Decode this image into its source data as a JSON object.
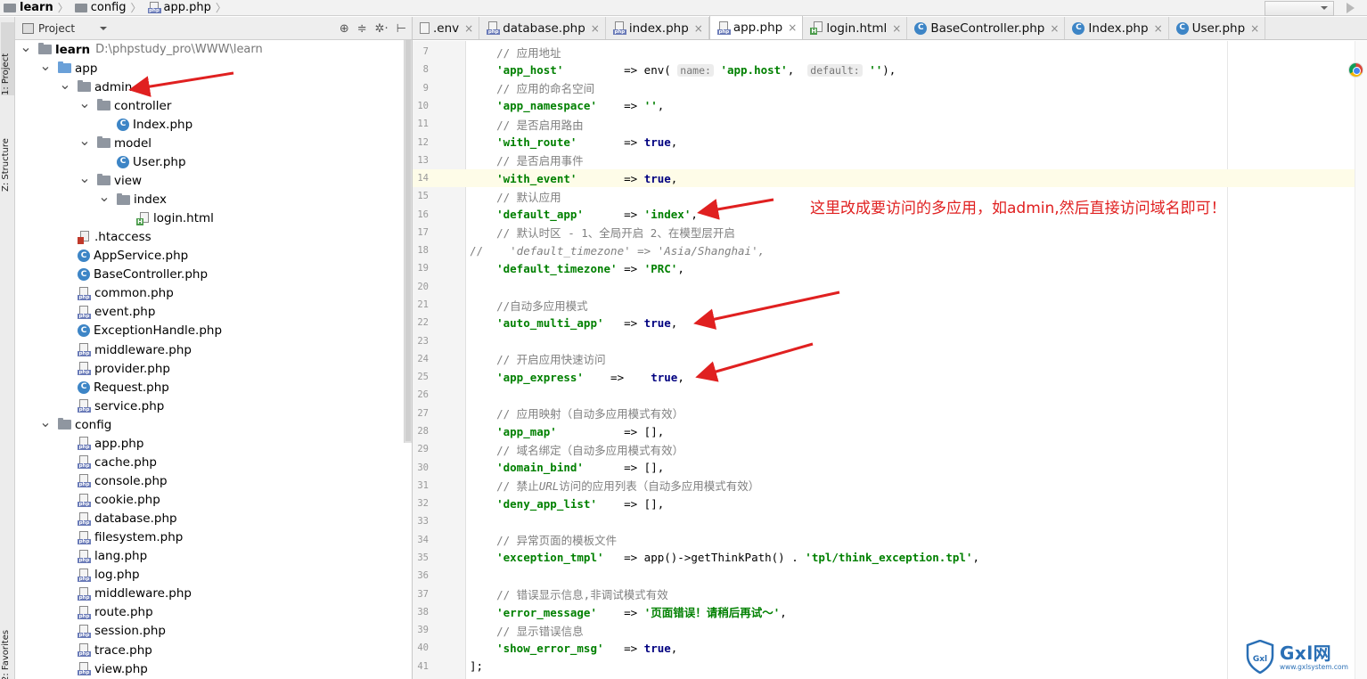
{
  "breadcrumb": [
    {
      "label": "learn",
      "icon": "folder-icon",
      "bold": true
    },
    {
      "label": "config",
      "icon": "folder-icon",
      "bold": false
    },
    {
      "label": "app.php",
      "icon": "php-file-icon",
      "bold": false
    }
  ],
  "tool_stripe": {
    "project_tab": "1: Project",
    "structure_tab": "Z: Structure",
    "favorites_tab": "2: Favorites"
  },
  "project_panel": {
    "title": "Project",
    "tree": [
      {
        "depth": 0,
        "arrow": "down",
        "icon": "folder",
        "label": "learn",
        "bold": true,
        "path": "D:\\phpstudy_pro\\WWW\\learn"
      },
      {
        "depth": 1,
        "arrow": "down",
        "icon": "folder-blue",
        "label": "app"
      },
      {
        "depth": 2,
        "arrow": "down",
        "icon": "folder",
        "label": "admin"
      },
      {
        "depth": 3,
        "arrow": "down",
        "icon": "folder",
        "label": "controller"
      },
      {
        "depth": 4,
        "arrow": "",
        "icon": "class",
        "label": "Index.php"
      },
      {
        "depth": 3,
        "arrow": "down",
        "icon": "folder",
        "label": "model"
      },
      {
        "depth": 4,
        "arrow": "",
        "icon": "class",
        "label": "User.php"
      },
      {
        "depth": 3,
        "arrow": "down",
        "icon": "folder",
        "label": "view"
      },
      {
        "depth": 4,
        "arrow": "down",
        "icon": "folder",
        "label": "index"
      },
      {
        "depth": 5,
        "arrow": "",
        "icon": "html",
        "label": "login.html"
      },
      {
        "depth": 2,
        "arrow": "",
        "icon": "htaccess",
        "label": ".htaccess"
      },
      {
        "depth": 2,
        "arrow": "",
        "icon": "class",
        "label": "AppService.php"
      },
      {
        "depth": 2,
        "arrow": "",
        "icon": "class",
        "label": "BaseController.php"
      },
      {
        "depth": 2,
        "arrow": "",
        "icon": "php",
        "label": "common.php"
      },
      {
        "depth": 2,
        "arrow": "",
        "icon": "php",
        "label": "event.php"
      },
      {
        "depth": 2,
        "arrow": "",
        "icon": "class",
        "label": "ExceptionHandle.php"
      },
      {
        "depth": 2,
        "arrow": "",
        "icon": "php",
        "label": "middleware.php"
      },
      {
        "depth": 2,
        "arrow": "",
        "icon": "php",
        "label": "provider.php"
      },
      {
        "depth": 2,
        "arrow": "",
        "icon": "class",
        "label": "Request.php"
      },
      {
        "depth": 2,
        "arrow": "",
        "icon": "php",
        "label": "service.php"
      },
      {
        "depth": 1,
        "arrow": "down",
        "icon": "folder",
        "label": "config"
      },
      {
        "depth": 2,
        "arrow": "",
        "icon": "php",
        "label": "app.php"
      },
      {
        "depth": 2,
        "arrow": "",
        "icon": "php",
        "label": "cache.php"
      },
      {
        "depth": 2,
        "arrow": "",
        "icon": "php",
        "label": "console.php"
      },
      {
        "depth": 2,
        "arrow": "",
        "icon": "php",
        "label": "cookie.php"
      },
      {
        "depth": 2,
        "arrow": "",
        "icon": "php",
        "label": "database.php"
      },
      {
        "depth": 2,
        "arrow": "",
        "icon": "php",
        "label": "filesystem.php"
      },
      {
        "depth": 2,
        "arrow": "",
        "icon": "php",
        "label": "lang.php"
      },
      {
        "depth": 2,
        "arrow": "",
        "icon": "php",
        "label": "log.php"
      },
      {
        "depth": 2,
        "arrow": "",
        "icon": "php",
        "label": "middleware.php"
      },
      {
        "depth": 2,
        "arrow": "",
        "icon": "php",
        "label": "route.php"
      },
      {
        "depth": 2,
        "arrow": "",
        "icon": "php",
        "label": "session.php"
      },
      {
        "depth": 2,
        "arrow": "",
        "icon": "php",
        "label": "trace.php"
      },
      {
        "depth": 2,
        "arrow": "",
        "icon": "php",
        "label": "view.php"
      }
    ]
  },
  "tabs": [
    {
      "label": ".env",
      "icon": "env",
      "active": false
    },
    {
      "label": "database.php",
      "icon": "php",
      "active": false
    },
    {
      "label": "index.php",
      "icon": "php",
      "active": false
    },
    {
      "label": "app.php",
      "icon": "php",
      "active": true
    },
    {
      "label": "login.html",
      "icon": "html",
      "active": false
    },
    {
      "label": "BaseController.php",
      "icon": "class",
      "active": false
    },
    {
      "label": "Index.php",
      "icon": "class",
      "active": false
    },
    {
      "label": "User.php",
      "icon": "class",
      "active": false
    }
  ],
  "editor": {
    "lines": [
      {
        "n": "7",
        "parts": [
          [
            "cm",
            "    // 应用地址"
          ]
        ]
      },
      {
        "n": "8",
        "parts": [
          [
            "str",
            "    'app_host'"
          ],
          [
            "pl",
            "         => env( "
          ],
          [
            "hint",
            "name:"
          ],
          [
            "str",
            " 'app.host'"
          ],
          [
            "pl",
            ",  "
          ],
          [
            "hint",
            "default:"
          ],
          [
            "str",
            " ''"
          ],
          [
            "pl",
            "),"
          ]
        ]
      },
      {
        "n": "9",
        "parts": [
          [
            "cm",
            "    // 应用的命名空间"
          ]
        ]
      },
      {
        "n": "10",
        "parts": [
          [
            "str",
            "    'app_namespace'"
          ],
          [
            "pl",
            "    => "
          ],
          [
            "str",
            "''"
          ],
          [
            "pl",
            ","
          ]
        ]
      },
      {
        "n": "11",
        "parts": [
          [
            "cm",
            "    // 是否启用路由"
          ]
        ]
      },
      {
        "n": "12",
        "parts": [
          [
            "str",
            "    'with_route'"
          ],
          [
            "pl",
            "       => "
          ],
          [
            "kw",
            "true"
          ],
          [
            "pl",
            ","
          ]
        ]
      },
      {
        "n": "13",
        "parts": [
          [
            "cm",
            "    // 是否启用事件"
          ]
        ]
      },
      {
        "n": "14",
        "hl": true,
        "parts": [
          [
            "str",
            "    'with_event'"
          ],
          [
            "pl",
            "       => "
          ],
          [
            "kw",
            "true"
          ],
          [
            "pl",
            ","
          ]
        ]
      },
      {
        "n": "15",
        "parts": [
          [
            "cm",
            "    // 默认应用"
          ]
        ]
      },
      {
        "n": "16",
        "parts": [
          [
            "str",
            "    'default_app'"
          ],
          [
            "pl",
            "      => "
          ],
          [
            "str",
            "'index'"
          ],
          [
            "pl",
            ","
          ]
        ]
      },
      {
        "n": "17",
        "parts": [
          [
            "cm",
            "    // 默认时区 - 1、全局开启 2、在模型层开启"
          ]
        ]
      },
      {
        "n": "18",
        "parts": [
          [
            "cm",
            "//    "
          ],
          [
            "it",
            "'default_timezone' => 'Asia/Shanghai',"
          ]
        ]
      },
      {
        "n": "19",
        "parts": [
          [
            "str",
            "    'default_timezone'"
          ],
          [
            "pl",
            " => "
          ],
          [
            "str",
            "'PRC'"
          ],
          [
            "pl",
            ","
          ]
        ]
      },
      {
        "n": "20",
        "parts": []
      },
      {
        "n": "21",
        "parts": [
          [
            "cm",
            "    //自动多应用模式"
          ]
        ]
      },
      {
        "n": "22",
        "parts": [
          [
            "str",
            "    'auto_multi_app'"
          ],
          [
            "pl",
            "   => "
          ],
          [
            "kw",
            "true"
          ],
          [
            "pl",
            ","
          ]
        ]
      },
      {
        "n": "23",
        "parts": []
      },
      {
        "n": "24",
        "parts": [
          [
            "cm",
            "    // 开启应用快速访问"
          ]
        ]
      },
      {
        "n": "25",
        "parts": [
          [
            "str",
            "    'app_express'"
          ],
          [
            "pl",
            "    =>    "
          ],
          [
            "kw",
            "true"
          ],
          [
            "pl",
            ","
          ]
        ]
      },
      {
        "n": "26",
        "parts": []
      },
      {
        "n": "27",
        "parts": [
          [
            "cm",
            "    // 应用映射（自动多应用模式有效）"
          ]
        ]
      },
      {
        "n": "28",
        "parts": [
          [
            "str",
            "    'app_map'"
          ],
          [
            "pl",
            "          => [],"
          ]
        ]
      },
      {
        "n": "29",
        "parts": [
          [
            "cm",
            "    // 域名绑定（自动多应用模式有效）"
          ]
        ]
      },
      {
        "n": "30",
        "parts": [
          [
            "str",
            "    'domain_bind'"
          ],
          [
            "pl",
            "      => [],"
          ]
        ]
      },
      {
        "n": "31",
        "parts": [
          [
            "cm",
            "    // 禁止"
          ],
          [
            "it",
            "URL"
          ],
          [
            "cm",
            "访问的应用列表（自动多应用模式有效）"
          ]
        ]
      },
      {
        "n": "32",
        "parts": [
          [
            "str",
            "    'deny_app_list'"
          ],
          [
            "pl",
            "    => [],"
          ]
        ]
      },
      {
        "n": "33",
        "parts": []
      },
      {
        "n": "34",
        "parts": [
          [
            "cm",
            "    // 异常页面的模板文件"
          ]
        ]
      },
      {
        "n": "35",
        "parts": [
          [
            "str",
            "    'exception_tmpl'"
          ],
          [
            "pl",
            "   => app()->getThinkPath() . "
          ],
          [
            "str",
            "'tpl/think_exception.tpl'"
          ],
          [
            "pl",
            ","
          ]
        ]
      },
      {
        "n": "36",
        "parts": []
      },
      {
        "n": "37",
        "parts": [
          [
            "cm",
            "    // 错误显示信息,非调试模式有效"
          ]
        ]
      },
      {
        "n": "38",
        "parts": [
          [
            "str",
            "    'error_message'"
          ],
          [
            "pl",
            "    => "
          ],
          [
            "str",
            "'页面错误！请稍后再试～'"
          ],
          [
            "pl",
            ","
          ]
        ]
      },
      {
        "n": "39",
        "parts": [
          [
            "cm",
            "    // 显示错误信息"
          ]
        ]
      },
      {
        "n": "40",
        "parts": [
          [
            "str",
            "    'show_error_msg'"
          ],
          [
            "pl",
            "   => "
          ],
          [
            "kw",
            "true"
          ],
          [
            "pl",
            ","
          ]
        ]
      },
      {
        "n": "41",
        "parts": [
          [
            "pl",
            "];"
          ]
        ]
      }
    ]
  },
  "annotation": {
    "text": "这里改成要访问的多应用，如admin,然后直接访问域名即可！",
    "color": "#e02020"
  },
  "watermark": {
    "shield_text": "Gxl",
    "brand": "Gxl网",
    "site": "www.gxlsystem.com"
  },
  "colors": {
    "string": "#008000",
    "keyword": "#000080",
    "comment": "#808080",
    "arrow": "#e02020"
  }
}
